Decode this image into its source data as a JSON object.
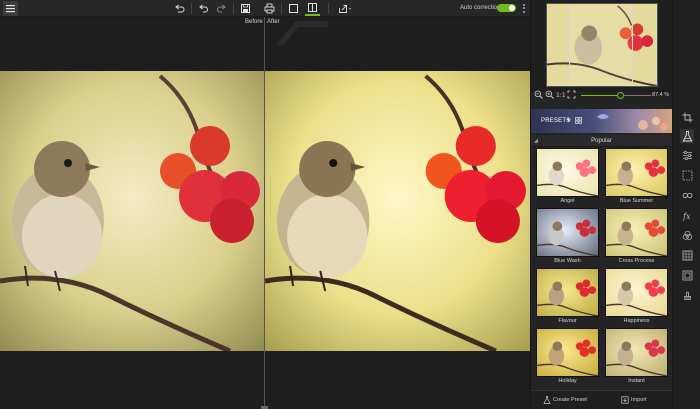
{
  "toolbar": {
    "before_label": "Before",
    "after_label": "After",
    "auto_correction_label": "Auto correction",
    "auto_correction_on": true,
    "icons": [
      "menu-icon",
      "undo-all-icon",
      "undo-icon",
      "redo-icon",
      "save-icon",
      "print-icon",
      "single-view-icon",
      "split-view-icon",
      "share-icon",
      "more-icon"
    ]
  },
  "navigator": {
    "zoom_value": "87.4 %",
    "zoom_fraction": 0.55,
    "icons": [
      "zoom-out-icon",
      "zoom-in-icon",
      "actual-size-icon",
      "fit-screen-icon"
    ]
  },
  "presets": {
    "header_label": "PRESETS",
    "category": "Popular",
    "items": [
      {
        "name": "Angel",
        "tone": "angel"
      },
      {
        "name": "Blue Summer",
        "tone": "warm"
      },
      {
        "name": "Blue Wash",
        "tone": "bluewash"
      },
      {
        "name": "Cross Process",
        "tone": "cross"
      },
      {
        "name": "Flavour",
        "tone": "flavour"
      },
      {
        "name": "Happiness",
        "tone": "happy"
      },
      {
        "name": "Holiday",
        "tone": "holiday"
      },
      {
        "name": "Instant",
        "tone": "instant"
      }
    ],
    "create_label": "Create Preset",
    "import_label": "Import"
  },
  "tools": [
    "crop-icon",
    "presets-flask-icon",
    "adjust-sliders-icon",
    "selection-icon",
    "red-eye-icon",
    "effects-fx-icon",
    "color-circles-icon",
    "texture-grid-icon",
    "frame-icon",
    "stamp-icon"
  ],
  "colors": {
    "accent": "#6fbd1f",
    "background": "#1e1e1e",
    "panel": "#242424"
  }
}
